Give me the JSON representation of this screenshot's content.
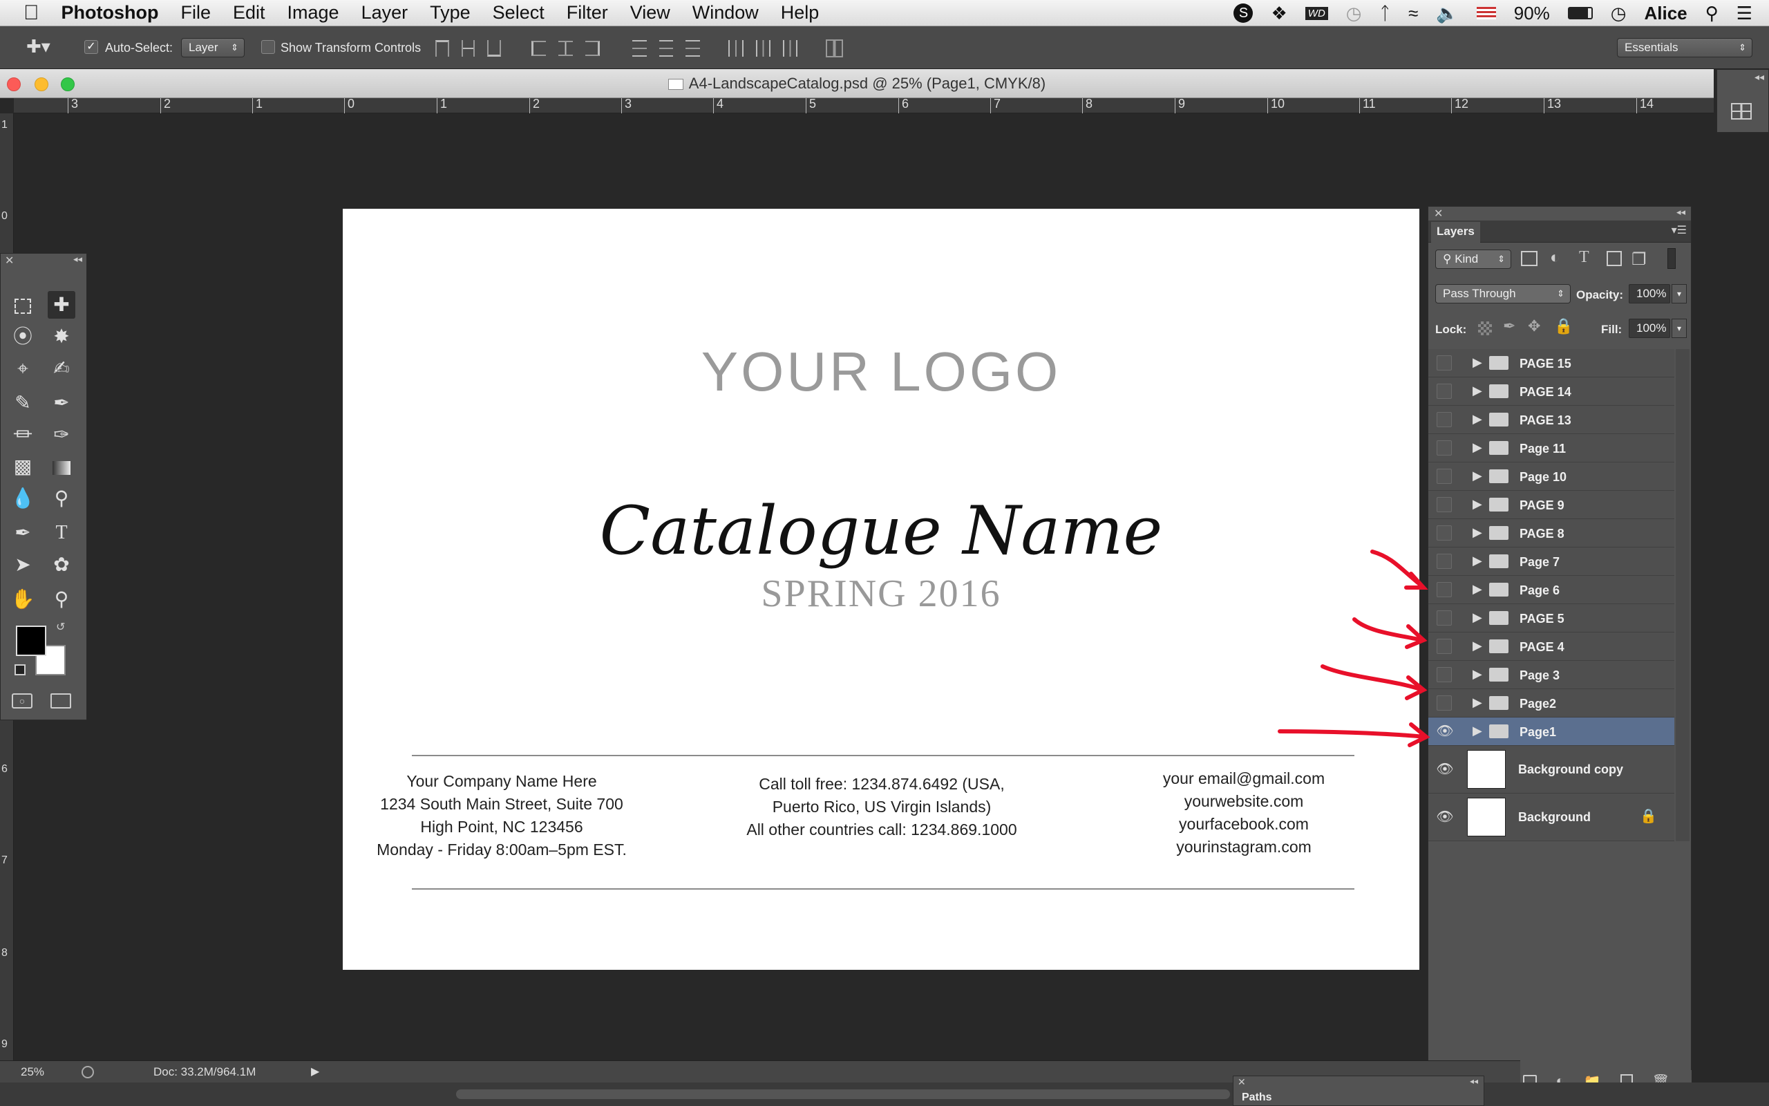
{
  "menubar": {
    "app": "Photoshop",
    "items": [
      "File",
      "Edit",
      "Image",
      "Layer",
      "Type",
      "Select",
      "Filter",
      "View",
      "Window",
      "Help"
    ],
    "battery": "90%",
    "user": "Alice"
  },
  "options": {
    "auto_select_label": "Auto-Select:",
    "auto_select_value": "Layer",
    "show_transform": "Show Transform Controls",
    "workspace": "Essentials"
  },
  "document": {
    "title": "A4-LandscapeCatalog.psd @ 25% (Page1, CMYK/8)",
    "ruler_labels": [
      "3",
      "2",
      "1",
      "0",
      "1",
      "2",
      "3",
      "4",
      "5",
      "6",
      "7",
      "8",
      "9",
      "10",
      "11",
      "12",
      "13",
      "14"
    ],
    "vruler_labels": [
      "1",
      "0",
      "6",
      "7",
      "8",
      "9"
    ],
    "logo": "YOUR LOGO",
    "catalogue": "Catalogue Name",
    "season": "SPRING 2016",
    "col1": [
      "Your Company Name Here",
      "1234 South Main Street, Suite 700",
      "High Point, NC 123456",
      "Monday - Friday 8:00am–5pm EST."
    ],
    "col2": [
      "Call toll free: 1234.874.6492 (USA,",
      "Puerto Rico, US Virgin Islands)",
      "All other countries call: 1234.869.1000"
    ],
    "col3": [
      "your email@gmail.com",
      "yourwebsite.com",
      "yourfacebook.com",
      "yourinstagram.com"
    ]
  },
  "layers_panel": {
    "tab": "Layers",
    "kind": "Kind",
    "blend": "Pass Through",
    "opacity_label": "Opacity:",
    "opacity": "100%",
    "lock_label": "Lock:",
    "fill_label": "Fill:",
    "fill": "100%",
    "groups": [
      "PAGE 15",
      "PAGE 14",
      "PAGE 13",
      "Page 11",
      "Page 10",
      "PAGE 9",
      "PAGE 8",
      "Page 7",
      "Page 6",
      "PAGE 5",
      "PAGE 4",
      "Page 3",
      "Page2",
      "Page1"
    ],
    "selected": "Page1",
    "background_copy": "Background copy",
    "background": "Background",
    "paths_tab": "Paths"
  },
  "status": {
    "zoom": "25%",
    "doc": "Doc: 33.2M/964.1M"
  },
  "colors": {
    "annotation_arrow": "#e8102a",
    "selected_layer": "#5b6f8f"
  }
}
